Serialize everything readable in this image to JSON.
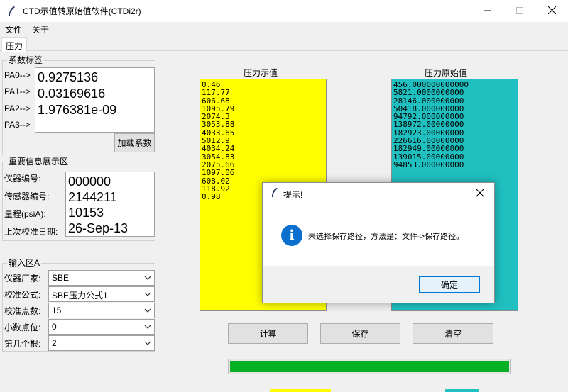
{
  "window": {
    "title": "CTD示值转原始值软件(CTDi2r)",
    "icon": "feather-icon",
    "minimize_icon": "minimize-icon",
    "maximize_icon": "maximize-icon",
    "close_icon": "close-icon"
  },
  "menu": {
    "items": [
      {
        "label": "文件"
      },
      {
        "label": "关于"
      }
    ]
  },
  "tabs": [
    {
      "label": "压力",
      "active": true
    }
  ],
  "coef_group": {
    "title": "系数标签",
    "labels": [
      "PA0-->",
      "PA1-->",
      "PA2-->",
      "PA3-->"
    ],
    "values": [
      "0.9275136",
      "0.03169616",
      "1.976381e-09",
      ""
    ],
    "load_button": "加载系数"
  },
  "info_group": {
    "title": "重要信息展示区",
    "rows": [
      {
        "label": "仪器编号:",
        "value": "000000"
      },
      {
        "label": "传感器编号:",
        "value": "2144211"
      },
      {
        "label": "量程(psiA):",
        "value": "10153"
      },
      {
        "label": "上次校准日期:",
        "value": "26-Sep-13"
      }
    ]
  },
  "input_group": {
    "title": "输入区A",
    "fields": [
      {
        "label": "仪器厂家:",
        "value": "SBE"
      },
      {
        "label": "校准公式:",
        "value": "SBE压力公式1"
      },
      {
        "label": "校准点数:",
        "value": "15"
      },
      {
        "label": "小数点位:",
        "value": "0"
      },
      {
        "label": "第几个根:",
        "value": "2"
      }
    ]
  },
  "display_values": {
    "title": "压力示值",
    "values": [
      "0.46",
      "117.77",
      "606.68",
      "1095.79",
      "2074.3",
      "3053.88",
      "4033.65",
      "5012.9",
      "4034.24",
      "3054.83",
      "2075.66",
      "1097.06",
      "608.02",
      "118.92",
      "0.98"
    ]
  },
  "raw_values": {
    "title": "压力原始值",
    "values": [
      "456.000000000000",
      "5821.0000000000",
      "28146.000000000",
      "50418.000000000",
      "94792.000000000",
      "138972.00000000",
      "182923.00000000",
      "226616.00000000",
      "182949.00000000",
      "139015.00000000",
      "94853.000000000"
    ]
  },
  "actions": {
    "compute": "计算",
    "save": "保存",
    "clear": "清空"
  },
  "progress": {
    "value": 1.0
  },
  "dialog": {
    "title": "提示!",
    "message": "未选择保存路径，方法是：文件->保存路径。",
    "ok": "确定",
    "icon": "info-icon",
    "close_icon": "close-icon"
  },
  "colors": {
    "display_bg": "#ffff00",
    "raw_bg": "#20c0c0",
    "progress": "#06b025",
    "accent": "#0078d7"
  }
}
